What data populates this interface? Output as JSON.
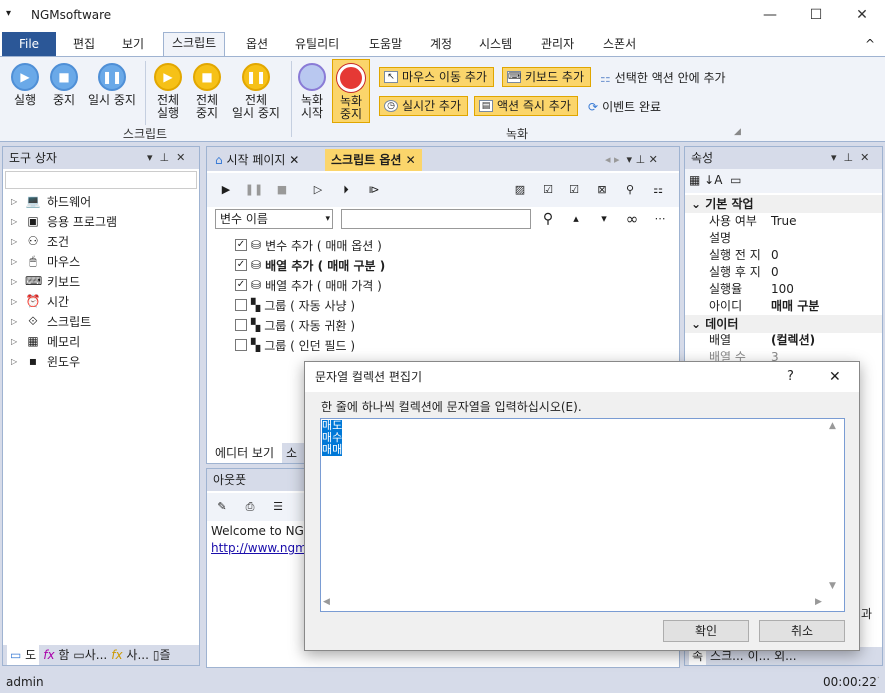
{
  "window": {
    "title": "NGMsoftware",
    "menu_glyph": "▾",
    "min": "—",
    "max": "☐",
    "close": "✕"
  },
  "menu": {
    "file": "File",
    "items": [
      "편집",
      "보기",
      "스크립트",
      "옵션",
      "유틸리티",
      "도움말",
      "계정",
      "시스템",
      "관리자",
      "스폰서"
    ],
    "collapse": "^"
  },
  "ribbon": {
    "script_group": {
      "label": "스크립트",
      "buttons": [
        {
          "line1": "실행",
          "line2": "",
          "icon": "▶",
          "color": "blue"
        },
        {
          "line1": "중지",
          "line2": "",
          "icon": "■",
          "color": "blue"
        },
        {
          "line1": "일시 중지",
          "line2": "",
          "icon": "❚❚",
          "color": "blue"
        },
        {
          "line1": "전체",
          "line2": "실행",
          "icon": "▶",
          "color": "yellow"
        },
        {
          "line1": "전체",
          "line2": "중지",
          "icon": "■",
          "color": "yellow"
        },
        {
          "line1": "전체",
          "line2": "일시 중지",
          "icon": "❚❚",
          "color": "yellow"
        }
      ]
    },
    "record_group": {
      "label": "녹화",
      "start": {
        "line1": "녹화",
        "line2": "시작"
      },
      "stop": {
        "line1": "녹화",
        "line2": "중지"
      },
      "mouse_move": "마우스 이동 추가",
      "keyboard": "키보드 추가",
      "selected_action": "선택한 액션 안에 추가",
      "delay": "실시간 추가",
      "immediate": "액션 즉시 추가",
      "event_done": "이벤트 완료"
    }
  },
  "toolbox": {
    "title": "도구 상자",
    "items": [
      "하드웨어",
      "응용 프로그램",
      "조건",
      "마우스",
      "키보드",
      "시간",
      "스크립트",
      "메모리",
      "윈도우"
    ],
    "icons": [
      "💻",
      "▣",
      "⚇",
      "🖱",
      "⌨",
      "⏰",
      "⟐",
      "▦",
      "▪"
    ],
    "bottom_tabs": [
      "도",
      "함",
      "사...",
      "사...",
      "즐"
    ]
  },
  "doc": {
    "tabs": [
      "시작 페이지",
      "스크립트 옵션"
    ],
    "var_select": "변수 이름",
    "actions": [
      {
        "label": "변수 추가 ( 매매 옵션 )",
        "checked": true,
        "bold": false
      },
      {
        "label": "배열 추가 ( 매매 구분 )",
        "checked": true,
        "bold": true
      },
      {
        "label": "배열 추가 ( 매매 가격 )",
        "checked": true,
        "bold": false
      },
      {
        "label": "그룹 ( 자동 사냥 )",
        "checked": false,
        "bold": false
      },
      {
        "label": "그룹 ( 자동 귀환 )",
        "checked": false,
        "bold": false
      },
      {
        "label": "그룹 ( 인던 필드 )",
        "checked": false,
        "bold": false
      }
    ],
    "bottom_tabs": [
      "에디터 보기",
      "소"
    ]
  },
  "output": {
    "title": "아웃풋",
    "line1": "Welcome to NGM",
    "line2": "http://www.ngm"
  },
  "props": {
    "title": "속성",
    "cat1": "기본 작업",
    "rows1": [
      {
        "k": "사용 여부",
        "v": "True",
        "bold": false
      },
      {
        "k": "설명",
        "v": "",
        "bold": false
      },
      {
        "k": "실행 전 지",
        "v": "0",
        "bold": false
      },
      {
        "k": "실행 후 지",
        "v": "0",
        "bold": false
      },
      {
        "k": "실행율",
        "v": "100",
        "bold": false
      },
      {
        "k": "아이디",
        "v": "매매 구분",
        "bold": true
      }
    ],
    "cat2": "데이터",
    "rows2": [
      {
        "k": "배열",
        "v": "(컬렉션)",
        "bold": true
      },
      {
        "k": "배열 수",
        "v": "3",
        "bold": false
      }
    ],
    "side_text": "과",
    "bottom_tabs": [
      "속",
      "스크...",
      "이...",
      "외..."
    ]
  },
  "status": {
    "user": "admin",
    "time": "00:00:22"
  },
  "dialog": {
    "title": "문자열 컬렉션 편집기",
    "help": "?",
    "close": "✕",
    "instruction": "한 줄에 하나씩 컬렉션에 문자열을 입력하십시오(E).",
    "lines": [
      "매도",
      "매수",
      "매매"
    ],
    "ok": "확인",
    "cancel": "취소"
  }
}
